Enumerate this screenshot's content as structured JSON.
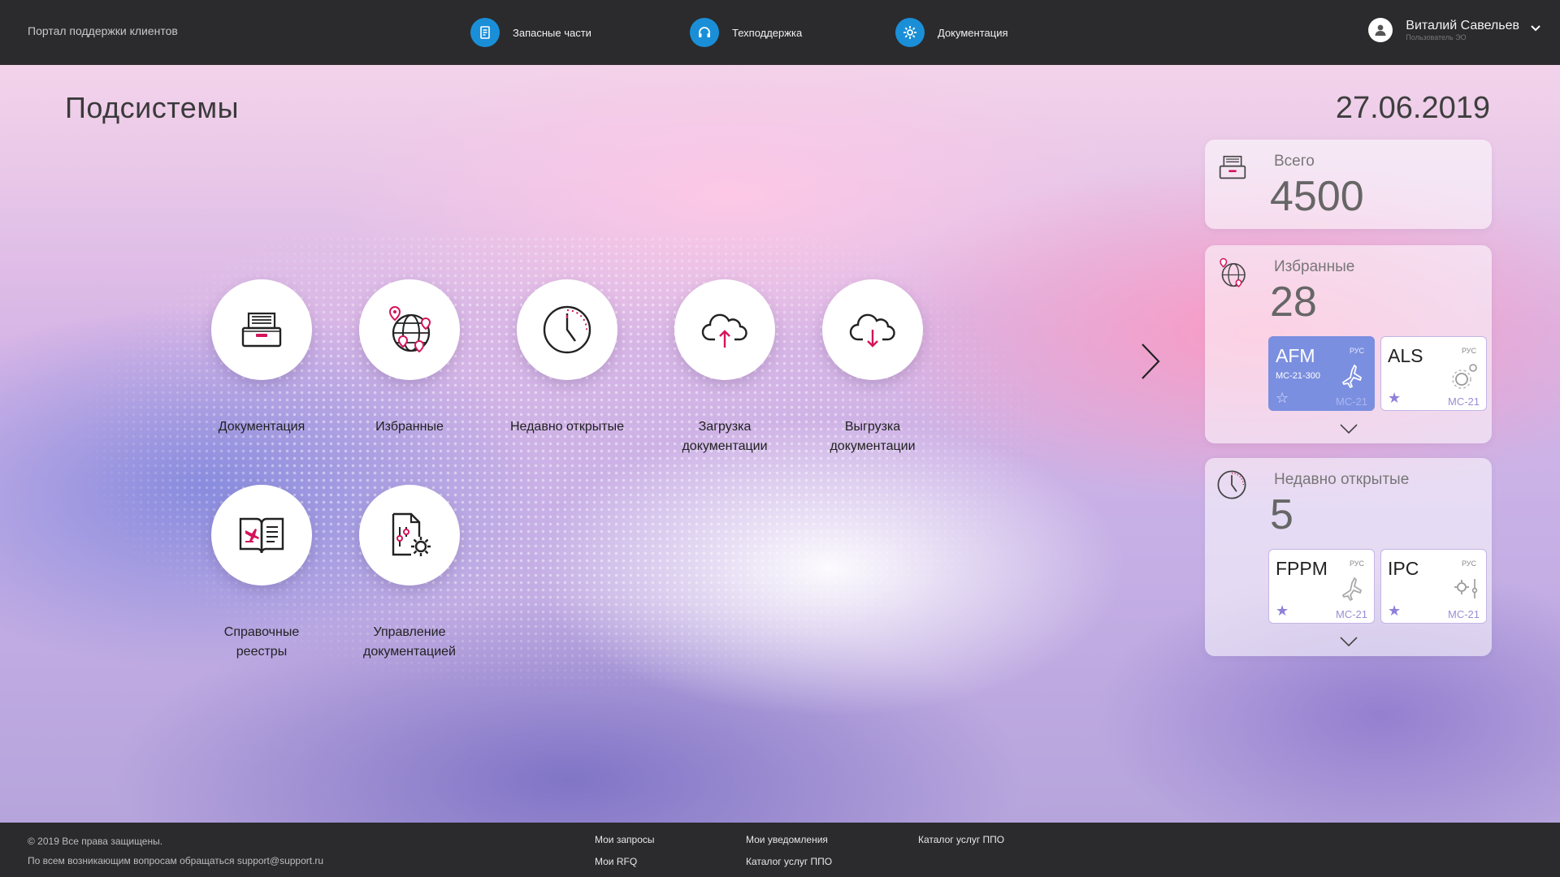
{
  "header": {
    "portal_title": "Портал поддержки клиентов",
    "nav": [
      {
        "label": "Запасные части",
        "icon": "spare-parts-icon"
      },
      {
        "label": "Техподдержка",
        "icon": "headset-icon"
      },
      {
        "label": "Документация",
        "icon": "gear-doc-icon"
      }
    ],
    "user": {
      "name": "Виталий Савельев",
      "role": "Пользователь ЭО"
    }
  },
  "main": {
    "title": "Подсистемы",
    "date": "27.06.2019",
    "tiles": [
      {
        "label": "Документация",
        "icon": "archive-box-icon"
      },
      {
        "label": "Избранные",
        "icon": "globe-pins-icon"
      },
      {
        "label": "Недавно открытые",
        "icon": "clock-icon"
      },
      {
        "label": "Загрузка документации",
        "icon": "cloud-upload-icon"
      },
      {
        "label": "Выгрузка документации",
        "icon": "cloud-download-icon"
      },
      {
        "label": "Справочные реестры",
        "icon": "book-plane-icon"
      },
      {
        "label": "Управление документацией",
        "icon": "doc-settings-icon"
      }
    ]
  },
  "panel": {
    "total": {
      "label": "Всего",
      "value": "4500",
      "icon": "archive-box-icon"
    },
    "favorites": {
      "label": "Избранные",
      "value": "28",
      "icon": "globe-pins-icon",
      "items": [
        {
          "code": "AFM",
          "lang": "РУС",
          "model": "МС-21-300",
          "aircraft": "МС-21",
          "starred": false,
          "active": true,
          "icon": "plane-icon"
        },
        {
          "code": "ALS",
          "lang": "РУС",
          "model": "",
          "aircraft": "МС-21",
          "starred": true,
          "active": false,
          "icon": "gears-icon"
        }
      ]
    },
    "recent": {
      "label": "Недавно открытые",
      "value": "5",
      "icon": "clock-icon",
      "items": [
        {
          "code": "FPPM",
          "lang": "РУС",
          "aircraft": "МС-21",
          "starred": true,
          "icon": "plane-icon"
        },
        {
          "code": "IPC",
          "lang": "РУС",
          "aircraft": "МС-21",
          "starred": true,
          "icon": "gear-sliders-icon"
        }
      ]
    }
  },
  "footer": {
    "copyright": "© 2019 Все права защищены.",
    "contact": "По всем возникающим вопросам обращаться support@support.ru",
    "links": [
      "Мои запросы",
      "Мои RFQ",
      "Мои уведомления",
      "Каталог услуг ППО",
      "Каталог услуг ППО"
    ]
  },
  "colors": {
    "accent_blue": "#1a8fd8",
    "accent_pink": "#d4145a",
    "header_bg": "#2b2b2d",
    "active_card": "#7b8fe0"
  }
}
